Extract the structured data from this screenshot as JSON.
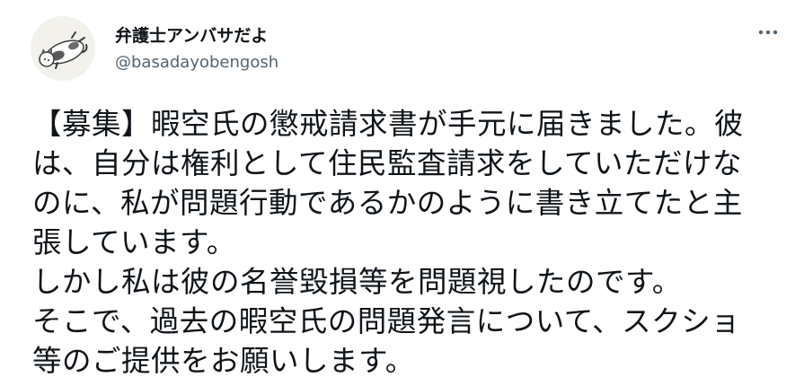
{
  "author": {
    "display_name": "弁護士アンバサだよ",
    "handle": "@basadayobengosh",
    "avatar_icon": "cat-avatar-icon"
  },
  "menu": {
    "icon": "more-horizontal-icon"
  },
  "tweet": {
    "lines": [
      "【募集】暇空氏の懲戒請求書が手元に届きました。彼",
      "は、自分は権利として住民監査請求をしていただけな",
      "のに、私が問題行動であるかのように書き立てたと主",
      "張しています。",
      "しかし私は彼の名誉毀損等を問題視したのです。",
      "そこで、過去の暇空氏の問題発言について、スクショ",
      "等のご提供をお願いします。"
    ]
  },
  "colors": {
    "text_primary": "#0f1419",
    "text_secondary": "#536471",
    "background": "#ffffff"
  }
}
